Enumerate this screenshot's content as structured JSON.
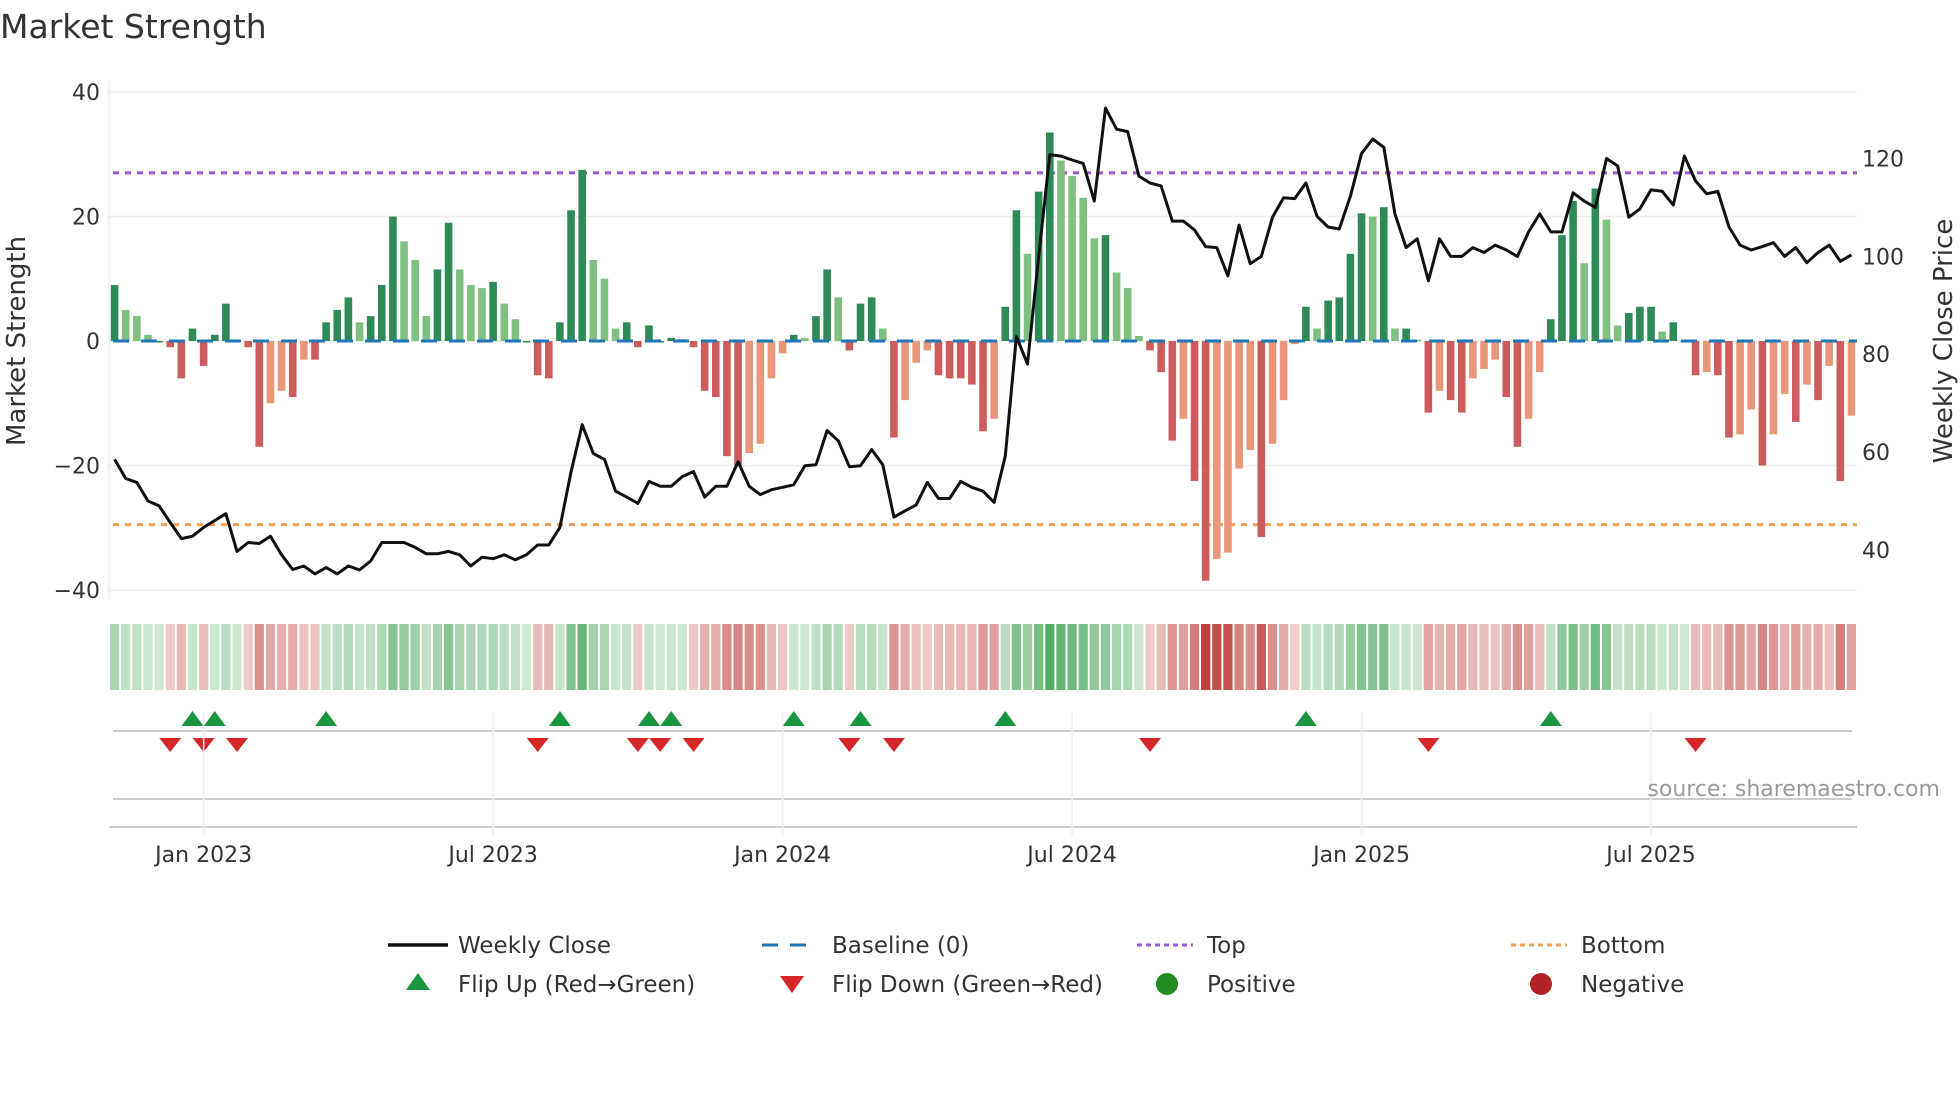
{
  "chart_data": {
    "type": "bar",
    "title": "Market Strength",
    "ylabel": "Market Strength",
    "y2label": "Weekly Close Price",
    "ylim": [
      -40,
      40
    ],
    "y2lim": [
      31.8,
      133.6
    ],
    "yticks": [
      "40",
      "20",
      "0",
      "−20",
      "−40"
    ],
    "ytick_values": [
      40,
      20,
      0,
      -20,
      -40
    ],
    "y2ticks": [
      "120",
      "100",
      "80",
      "60",
      "40"
    ],
    "y2tick_values": [
      120,
      100,
      80,
      60,
      40
    ],
    "x_start_date": "2022-11-06",
    "x_step_days": 7,
    "xticks": [
      {
        "label": "Jan 2023",
        "week": 8
      },
      {
        "label": "Jul 2023",
        "week": 34
      },
      {
        "label": "Jan 2024",
        "week": 60
      },
      {
        "label": "Jul 2024",
        "week": 86
      },
      {
        "label": "Jan 2025",
        "week": 112
      },
      {
        "label": "Jul 2025",
        "week": 138
      }
    ],
    "top_level": 27,
    "bottom_level": -29.5,
    "baseline": 0,
    "strength": [
      9,
      5,
      4,
      1,
      0,
      -1,
      -6,
      2,
      -4,
      1,
      6,
      0,
      -1,
      -17,
      -10,
      -8,
      -9,
      -3,
      -3,
      3,
      5,
      7,
      3,
      4,
      9,
      20,
      16,
      13,
      4,
      11.5,
      19,
      11.5,
      9,
      8.5,
      9.5,
      6,
      3.5,
      0,
      -5.5,
      -6,
      3,
      21,
      27.5,
      13,
      10,
      2,
      3,
      -1,
      2.5,
      0,
      0.5,
      0.3,
      -1,
      -8,
      -9,
      -18.5,
      -20,
      -18,
      -16.5,
      -6,
      -2,
      1,
      0.5,
      4,
      11.5,
      7,
      -1.5,
      6,
      7,
      2,
      -15.5,
      -9.5,
      -3.5,
      -1.5,
      -5.5,
      -6,
      -6,
      -7,
      -14.5,
      -12.5,
      5.5,
      21,
      14,
      24,
      33.5,
      29,
      26.5,
      23,
      16.5,
      17,
      11,
      8.5,
      0.8,
      -1.5,
      -5,
      -16,
      -12.5,
      -22.5,
      -38.5,
      -35,
      -34,
      -20.5,
      -17.5,
      -31.5,
      -16.5,
      -9.5,
      -0.5,
      5.5,
      2,
      6.5,
      7,
      14,
      20.5,
      20,
      21.5,
      2,
      2,
      0.2,
      -11.5,
      -8,
      -9.5,
      -11.5,
      -6,
      -4.5,
      -3,
      -9,
      -17,
      -12.5,
      -5,
      3.5,
      17,
      22.5,
      12.5,
      24.5,
      19.5,
      2.5,
      4.5,
      5.5,
      5.5,
      1.5,
      3,
      0,
      -5.5,
      -5,
      -5.5,
      -15.5,
      -15,
      -11,
      -20,
      -15,
      -8.5,
      -13,
      -7,
      -9.5,
      -4,
      -22.5,
      -12
    ],
    "weekly_close": [
      58.5,
      54.6,
      53.8,
      50,
      49,
      45.6,
      42.3,
      42.8,
      44.6,
      46,
      47.4,
      39.7,
      41.5,
      41.3,
      42.8,
      39,
      36,
      36.7,
      35.1,
      36.4,
      35.1,
      36.7,
      35.9,
      37.7,
      41.5,
      41.5,
      41.5,
      40.5,
      39.2,
      39.2,
      39.7,
      39,
      36.7,
      38.5,
      38.2,
      39,
      38,
      39,
      41,
      41,
      44.6,
      56,
      65.6,
      59.7,
      58.5,
      52,
      50.8,
      49.5,
      54,
      53,
      53,
      55,
      56,
      50.8,
      53,
      53,
      58,
      53,
      51.3,
      52.3,
      52.8,
      53.3,
      57.2,
      57.4,
      64.4,
      62.3,
      57,
      57.2,
      60.5,
      57.4,
      46.7,
      48,
      49.2,
      53.8,
      50.5,
      50.5,
      54,
      52.8,
      52,
      49.7,
      59.2,
      83.6,
      78,
      100,
      120.8,
      120.5,
      119.7,
      119,
      111.3,
      130.3,
      126,
      125.5,
      116.4,
      115,
      114.4,
      107.2,
      107.2,
      105.4,
      102,
      101.8,
      96,
      106.4,
      98.5,
      100,
      108,
      112,
      111.8,
      115,
      108.2,
      106,
      105.6,
      112.3,
      121,
      124,
      122.3,
      108.7,
      101.8,
      103.6,
      95,
      103.6,
      100,
      100,
      101.8,
      100.8,
      102.3,
      101.3,
      100,
      105,
      108.7,
      105,
      105,
      113,
      111.3,
      110,
      120,
      118.5,
      108,
      109.7,
      113.6,
      113.3,
      110.5,
      120.5,
      115.4,
      112.8,
      113.3,
      106,
      102.3,
      101.3,
      102,
      102.8,
      100,
      101.8,
      98.7,
      100.8,
      102.3,
      99,
      100.3
    ],
    "flip_up_weeks": [
      7,
      9,
      19,
      40,
      48,
      50,
      61,
      67,
      80,
      107,
      129
    ],
    "flip_down_weeks": [
      5,
      8,
      11,
      38,
      47,
      49,
      52,
      66,
      70,
      93,
      118,
      142
    ],
    "legend": [
      {
        "label": "Weekly Close",
        "kind": "line-solid"
      },
      {
        "label": "Baseline (0)",
        "kind": "line-dash"
      },
      {
        "label": "Top",
        "kind": "line-dot-purple"
      },
      {
        "label": "Bottom",
        "kind": "line-dot-orange"
      },
      {
        "label": "Flip Up (Red→Green)",
        "kind": "triangle-up"
      },
      {
        "label": "Flip Down (Green→Red)",
        "kind": "triangle-down"
      },
      {
        "label": "Positive",
        "kind": "dot-green"
      },
      {
        "label": "Negative",
        "kind": "dot-red"
      }
    ],
    "legend_position": "bottom",
    "grid": true
  },
  "source": "source: sharemaestro.com",
  "colors": {
    "pos_strong": "#2e8b57",
    "pos_weak": "#7fbf7f",
    "neg_strong": "#cd5c5c",
    "neg_weak": "#e9967a",
    "baseline": "#1f77b4",
    "top": "#9b59d0",
    "bottom": "#f0a050",
    "flip_up": "#1a9641",
    "flip_down": "#d62728",
    "positive": "#228b22",
    "negative": "#b22222",
    "close": "#111111"
  }
}
